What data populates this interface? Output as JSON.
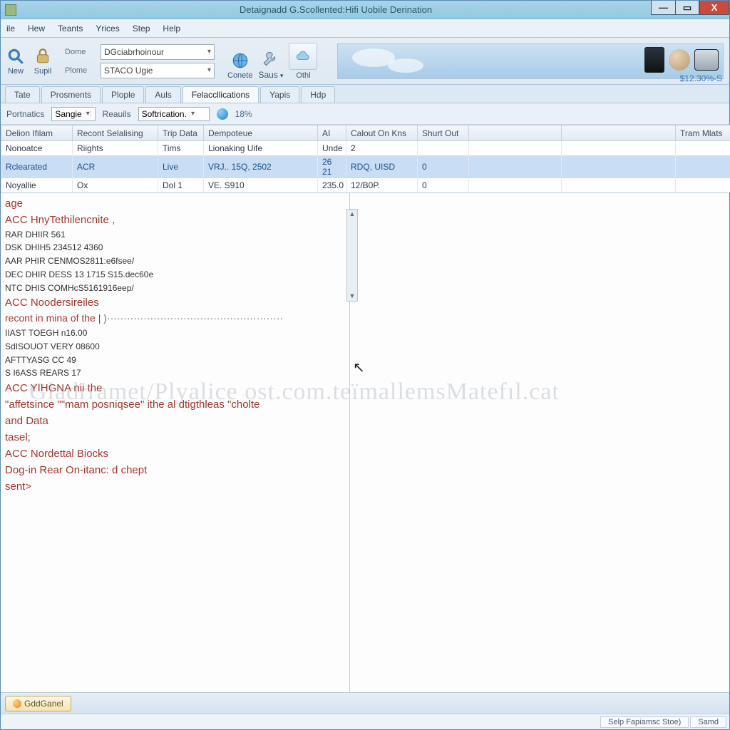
{
  "title": "Detaignadd G.Scollented:Hifi Uobile Derination",
  "menubar": [
    "ile",
    "Hew",
    "Teants",
    "Yrices",
    "Step",
    "Help"
  ],
  "ribbon": {
    "new_label": "New",
    "supl_label": "Supil",
    "form": {
      "dome_label": "Dome",
      "dome_value": "DGciabrhoinour",
      "plome_label": "Plome",
      "plome_value": "STACO Ugie"
    },
    "conete_label": "Conete",
    "saus_label": "Saus",
    "othi_label": "Othl"
  },
  "acct_text": "$12.30%-S",
  "tabs": [
    {
      "label": "Tate",
      "active": false
    },
    {
      "label": "Prosments",
      "active": false
    },
    {
      "label": "Plople",
      "active": false
    },
    {
      "label": "Auls",
      "active": false
    },
    {
      "label": "Felaccllications",
      "active": true
    },
    {
      "label": "Yapis",
      "active": false
    },
    {
      "label": "Hdp",
      "active": false
    }
  ],
  "filterbar": {
    "portnatics": "Portnatics",
    "sangie": "Sangie",
    "reauils": "Reauils",
    "softrication": "Softrication.",
    "pct": "18%"
  },
  "grid": {
    "cols": [
      "Delion Ifilam",
      "Recont Selalising",
      "Trip Data",
      "Dempoteue",
      "AI",
      "Calout On Kns",
      "Shurt Out",
      "",
      "",
      "Tram Mlats"
    ],
    "widths": [
      100,
      120,
      64,
      160,
      40,
      100,
      72,
      130,
      160,
      78
    ],
    "rows": [
      {
        "c": [
          "Nonoatce",
          "Riights",
          "Tims",
          "Lionaking Uife",
          "Unde",
          "2",
          "",
          "",
          "",
          ""
        ],
        "sel": false
      },
      {
        "c": [
          "Rclearated",
          "ACR",
          "Live",
          "VRJ.. 15Q, 2502",
          "26 21",
          "RDQ, UISD",
          "0",
          "",
          "",
          ""
        ],
        "sel": true
      },
      {
        "c": [
          "Noyallie",
          "Ox",
          "Dol 1",
          "VE. S910",
          "235.0",
          "12/B0P.",
          "0",
          "",
          "",
          ""
        ],
        "sel": false
      }
    ]
  },
  "detail": {
    "age": "age",
    "s1_hdr": "ACC HnyTethilencnite ,",
    "s1": [
      "RAR  DHIIR  561",
      "DSK  DHIH5  234512  4360",
      "AAR  PHIR  CENMOS2811:e6fsee/",
      "DEC  DHIR  DESS  13  1715  S15.dec60e",
      "NTC  DHIS  COMHcS5161916eep/"
    ],
    "s2_hdr": "ACC Noodersireiles",
    "s2_sub": "recont in mina of the |",
    "s2": [
      "IIAST  TOEGH    n16.00",
      "SdISOUOT  VERY  08600",
      "AFTTYASG  CC   49",
      "S I6ASS    REARS  17"
    ],
    "s3_hdr": "ACC YIHGNA nii the",
    "s3_body": "\"affetsince \"\"mam  posniqsee\" ithe al dtigthleas \"cholte",
    "s3_body2": "and Data",
    "s3_body3": "tasel;",
    "s4_hdr": "ACC Nordettal Biocks",
    "s4_body": "Dog-in Rear On-itanc: d chept",
    "s4_body2": "sent>"
  },
  "watermark": "Gladrramet/Plyalice   ost.com.teïmallemsMatefıl.cat",
  "bottom_btn": "GddGanel",
  "status": {
    "left": "Selp Fapiamsc Stoe)",
    "right": "Samd"
  }
}
